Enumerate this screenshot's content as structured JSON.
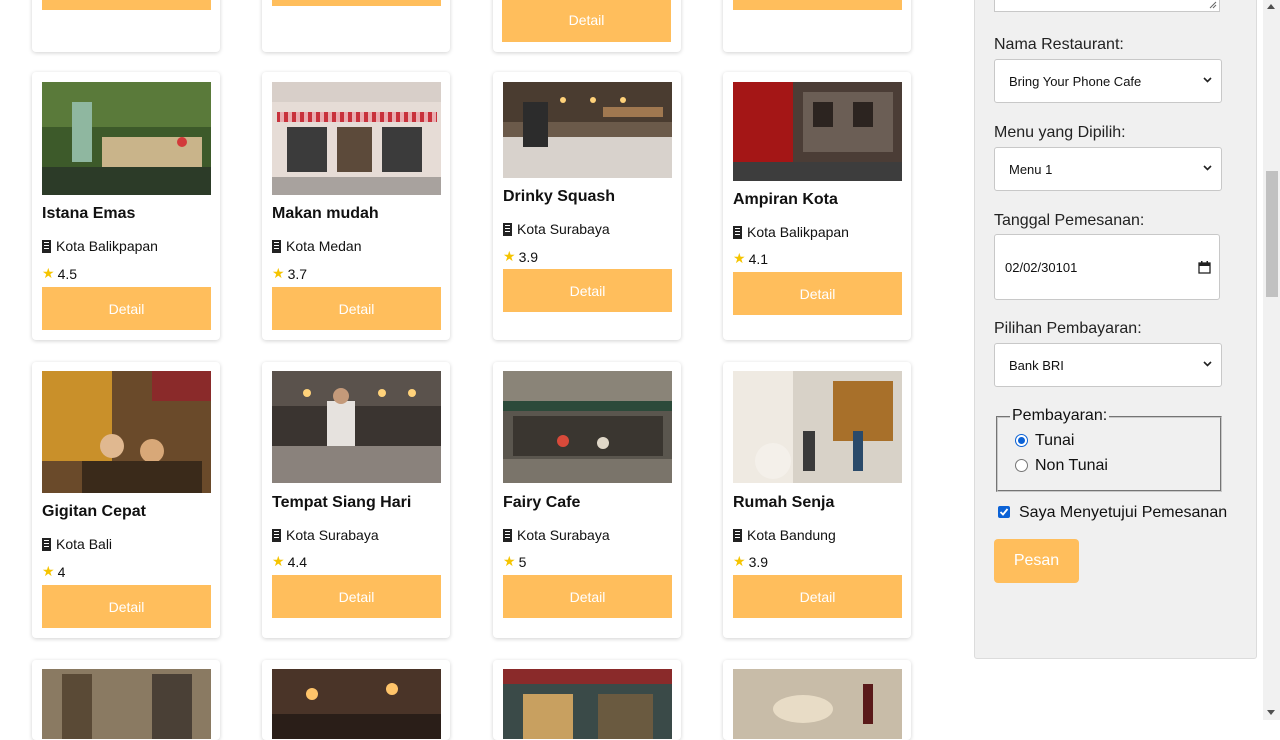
{
  "accent_color": "#ffbe5c",
  "restaurants": [
    {
      "name": "Istana Emas",
      "location": "Kota Balikpapan",
      "rating": "4.5",
      "button": "Detail"
    },
    {
      "name": "Makan mudah",
      "location": "Kota Medan",
      "rating": "3.7",
      "button": "Detail"
    },
    {
      "name": "Drinky Squash",
      "location": "Kota Surabaya",
      "rating": "3.9",
      "button": "Detail"
    },
    {
      "name": "Ampiran Kota",
      "location": "Kota Balikpapan",
      "rating": "4.1",
      "button": "Detail"
    },
    {
      "name": "Gigitan Cepat",
      "location": "Kota Bali",
      "rating": "4",
      "button": "Detail"
    },
    {
      "name": "Tempat Siang Hari",
      "location": "Kota Surabaya",
      "rating": "4.4",
      "button": "Detail"
    },
    {
      "name": "Fairy Cafe",
      "location": "Kota Surabaya",
      "rating": "5",
      "button": "Detail"
    },
    {
      "name": "Rumah Senja",
      "location": "Kota Bandung",
      "rating": "3.9",
      "button": "Detail"
    }
  ],
  "top_row": {
    "button": "Detail"
  },
  "order_form": {
    "restaurant_label": "Nama Restaurant:",
    "restaurant_value": "Bring Your Phone Cafe",
    "menu_label": "Menu yang Dipilih:",
    "menu_value": "Menu 1",
    "date_label": "Tanggal Pemesanan:",
    "date_value": "02/02/30101",
    "payment_option_label": "Pilihan Pembayaran:",
    "payment_option_value": "Bank BRI",
    "payment_legend": "Pembayaran:",
    "payment_cash": "Tunai",
    "payment_noncash": "Non Tunai",
    "agree_label": "Saya Menyetujui Pemesanan",
    "submit_label": "Pesan"
  }
}
